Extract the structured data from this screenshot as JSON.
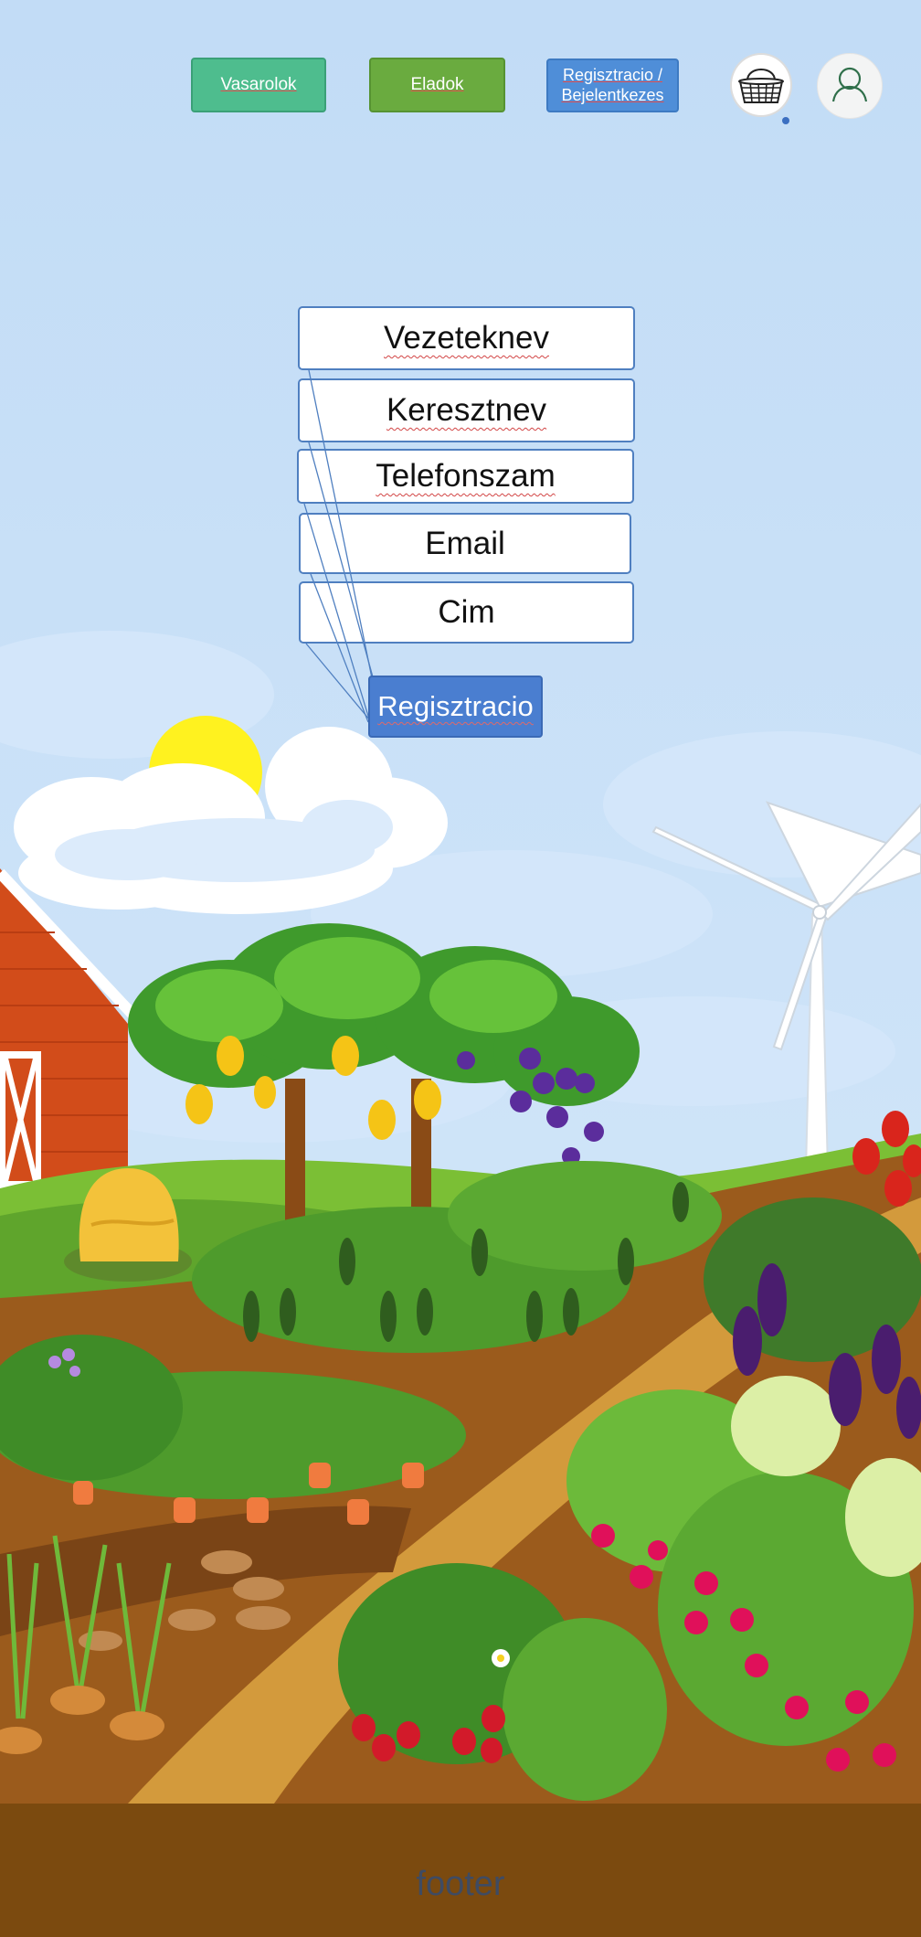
{
  "nav": {
    "buyers_label": "Vasarolok",
    "sellers_label": "Eladok",
    "auth_label_line1": "Regisztracio /",
    "auth_label_line2": "Bejelentkezes"
  },
  "icons": {
    "cart": "basket-icon",
    "profile": "user-icon",
    "cart_badge": "notification-dot"
  },
  "form": {
    "fields": [
      {
        "label": "Vezeteknev"
      },
      {
        "label": "Keresztnev"
      },
      {
        "label": "Telefonszam"
      },
      {
        "label": "Email"
      },
      {
        "label": "Cim"
      }
    ],
    "submit_label": "Regisztracio"
  },
  "footer": {
    "label": "footer"
  },
  "colors": {
    "buyers": "#4ebd8e",
    "sellers": "#6aab3f",
    "auth": "#4f8ed8",
    "submit": "#4a7ed0",
    "footer": "#7b4a0f",
    "sky": "#c2dcf6"
  }
}
